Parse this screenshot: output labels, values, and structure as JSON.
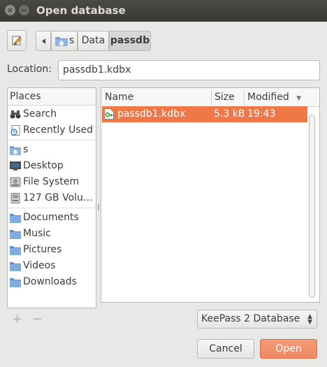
{
  "window": {
    "title": "Open database",
    "close_glyph": "×",
    "minimize_glyph": "−"
  },
  "breadcrumb": {
    "items": [
      "s",
      "Data",
      "passdb"
    ]
  },
  "location": {
    "label": "Location:",
    "value": "passdb1.kdbx"
  },
  "places": {
    "header": "Places",
    "items": [
      {
        "label": "Search",
        "icon": "binoculars-icon"
      },
      {
        "label": "Recently Used",
        "icon": "recent-document-icon"
      },
      {
        "label": "s",
        "icon": "home-folder-icon"
      },
      {
        "label": "Desktop",
        "icon": "desktop-icon"
      },
      {
        "label": "File System",
        "icon": "harddisk-icon"
      },
      {
        "label": "127 GB Volu…",
        "icon": "drive-icon"
      },
      {
        "label": "Documents",
        "icon": "folder-icon"
      },
      {
        "label": "Music",
        "icon": "folder-icon"
      },
      {
        "label": "Pictures",
        "icon": "folder-icon"
      },
      {
        "label": "Videos",
        "icon": "folder-icon"
      },
      {
        "label": "Downloads",
        "icon": "folder-icon"
      }
    ],
    "add_glyph": "+",
    "remove_glyph": "−"
  },
  "files": {
    "columns": {
      "name": "Name",
      "size": "Size",
      "modified": "Modified"
    },
    "sort_indicator": "▼",
    "rows": [
      {
        "name": "passdb1.kdbx",
        "size": "5.3 kB",
        "modified": "19:43",
        "selected": true
      }
    ]
  },
  "filter": {
    "selected": "KeePass 2 Database"
  },
  "buttons": {
    "cancel": "Cancel",
    "open": "Open"
  },
  "colors": {
    "accent": "#f07746",
    "titlebar": "#3b3a36"
  }
}
